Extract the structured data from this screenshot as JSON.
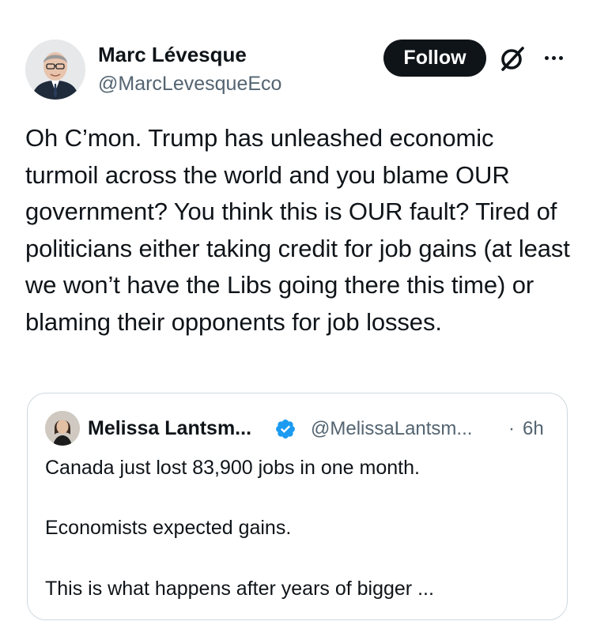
{
  "post": {
    "author_name": "Marc Lévesque",
    "author_handle": "@MarcLevesqueEco",
    "follow_label": "Follow",
    "text": "Oh C’mon. Trump has unleashed economic turmoil across the world and you blame OUR government? You think this is OUR fault? Tired of politicians either taking credit for job gains (at least we won’t have the Libs going there this time) or blaming their opponents for job losses."
  },
  "quoted": {
    "author_name": "Melissa Lantsm...",
    "author_handle": "@MelissaLantsm...",
    "separator": "·",
    "time": "6h",
    "lines": [
      "Canada just lost 83,900 jobs in one month.",
      "Economists expected gains.",
      "This is what happens after years of bigger ..."
    ]
  },
  "icons": {
    "verified": "verified-badge-icon",
    "grok": "grok-icon",
    "more": "more-options-icon"
  },
  "colors": {
    "text": "#0f1419",
    "secondary": "#536471",
    "verified": "#1d9bf0",
    "follow_bg": "#0f1419",
    "border": "#cfd9de"
  }
}
